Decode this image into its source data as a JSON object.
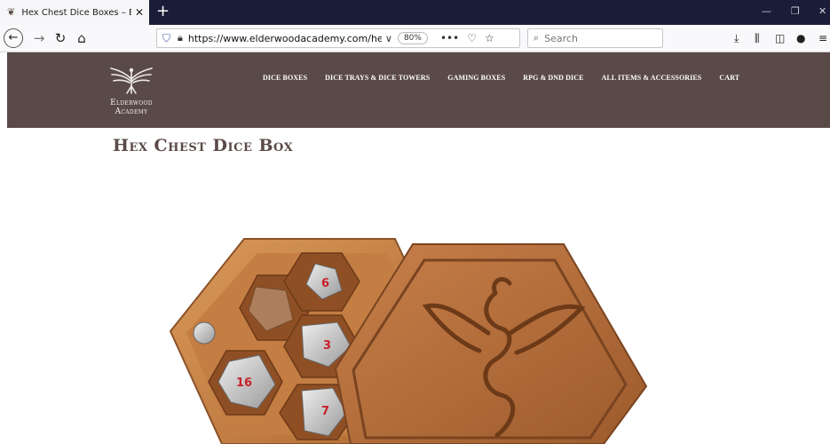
{
  "browser": {
    "tab": {
      "title": "Hex Chest Dice Boxes – Elderwo",
      "close": "✕"
    },
    "new_tab": "+",
    "window_controls": {
      "minimize": "—",
      "maximize": "❐",
      "close": "✕"
    },
    "nav": {
      "back": "←",
      "forward": "→",
      "reload": "↻",
      "home": "⌂"
    },
    "url": "https://www.elderwoodacademy.com/hex-chest-dice",
    "zoom": "80%",
    "url_actions": {
      "more": "•••",
      "pocket": "♡",
      "bookmark": "☆",
      "dropdown": "∨"
    },
    "search": {
      "placeholder": "Search"
    },
    "toolbar": {
      "downloads": "⤓",
      "library": "⫼",
      "sidebar": "◫",
      "account": "●",
      "menu": "≡"
    }
  },
  "site": {
    "logo_text": [
      "Elderwood",
      "Academy"
    ],
    "menu": [
      "DICE BOXES",
      "DICE TRAYS & DICE TOWERS",
      "GAMING BOXES",
      "RPG & DND DICE",
      "ALL ITEMS & ACCESSORIES",
      "CART"
    ],
    "brand_color": "#5a4a47"
  },
  "page": {
    "title": "Hex Chest Dice Box",
    "die_numbers": [
      "6",
      "3",
      "16",
      "7"
    ]
  }
}
